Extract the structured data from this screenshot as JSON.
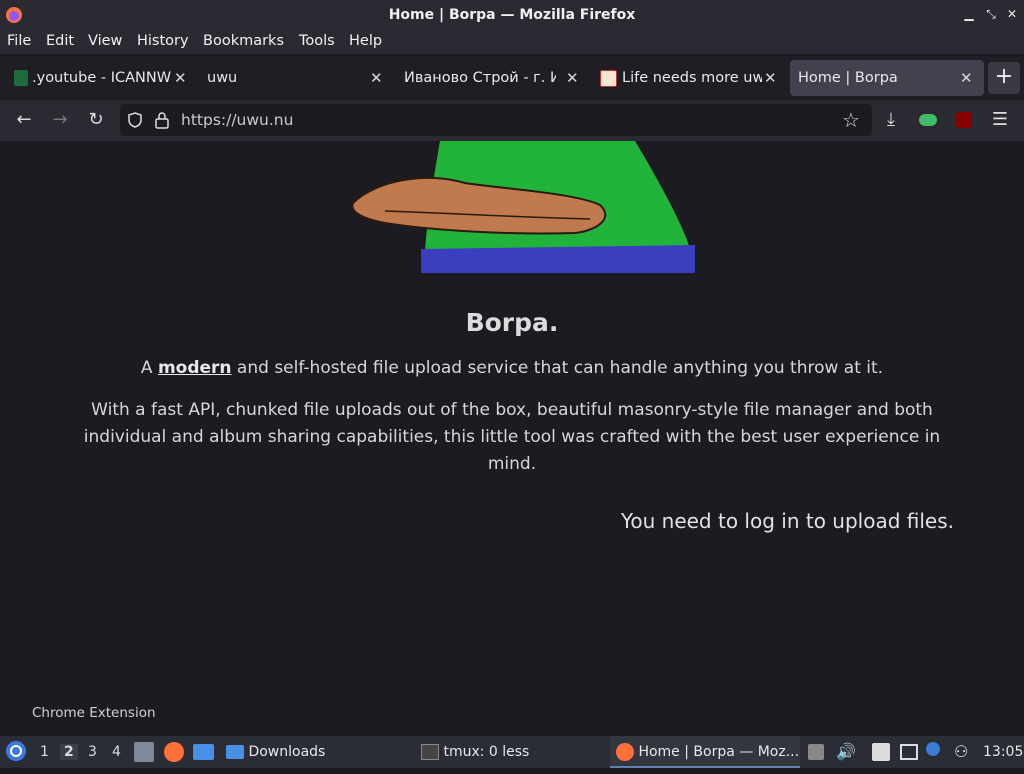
{
  "window": {
    "title": "Home | Borpa — Mozilla Firefox"
  },
  "menu": [
    "File",
    "Edit",
    "View",
    "History",
    "Bookmarks",
    "Tools",
    "Help"
  ],
  "tabs": [
    {
      "label": ".youtube - ICANNW",
      "active": false
    },
    {
      "label": "uwu",
      "active": false
    },
    {
      "label": "Иваново Строй - г. И",
      "active": false
    },
    {
      "label": "Life needs more uw",
      "active": false
    },
    {
      "label": "Home | Borpa",
      "active": true
    }
  ],
  "newtab": "+",
  "url": "https://uwu.nu",
  "page": {
    "heading": "Borpa.",
    "para1_pre": "A ",
    "para1_link": "modern",
    "para1_post": " and self-hosted file upload service that can handle anything you throw at it.",
    "para2": "With a fast API, chunked file uploads out of the box, beautiful masonry-style file manager and both individual and album sharing capabilities, this little tool was crafted with the best user experience in mind.",
    "login_msg": "You need to log in to upload files.",
    "footer": "Chrome Extension"
  },
  "taskbar": {
    "workspaces": [
      "1",
      "2",
      "3",
      "4"
    ],
    "active_workspace": "2",
    "downloads": "Downloads",
    "tmux": "tmux: 0 less",
    "firefox_task": "Home | Borpa — Moz...",
    "clock": "13:05"
  },
  "colors": {
    "accent": "#5e81ac",
    "bg": "#1c1b22",
    "chrome": "#2b2a33"
  }
}
